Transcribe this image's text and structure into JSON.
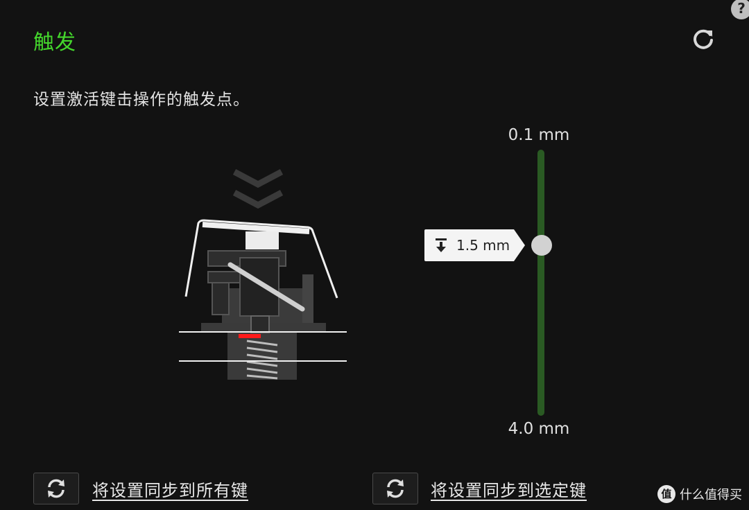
{
  "header": {
    "title": "触发",
    "reset_icon": "reset-icon",
    "help_label": "?"
  },
  "description": "设置激活键击操作的触发点。",
  "actuation_slider": {
    "max_label": "0.1 mm",
    "min_label": "4.0 mm",
    "min_value": 0.1,
    "max_value": 4.0,
    "current_value": 1.5,
    "value_label": "1.5 mm",
    "value_icon": "press-down-icon",
    "track_color": "#2a5a23"
  },
  "sync_actions": [
    {
      "icon": "sync-icon",
      "label": "将设置同步到所有键"
    },
    {
      "icon": "sync-icon",
      "label": "将设置同步到选定键"
    }
  ],
  "watermark": {
    "logo_text": "值",
    "text": "什么值得买"
  },
  "colors": {
    "accent": "#44d62c",
    "background": "#121212",
    "actuation_marker": "#ff1a1a"
  }
}
